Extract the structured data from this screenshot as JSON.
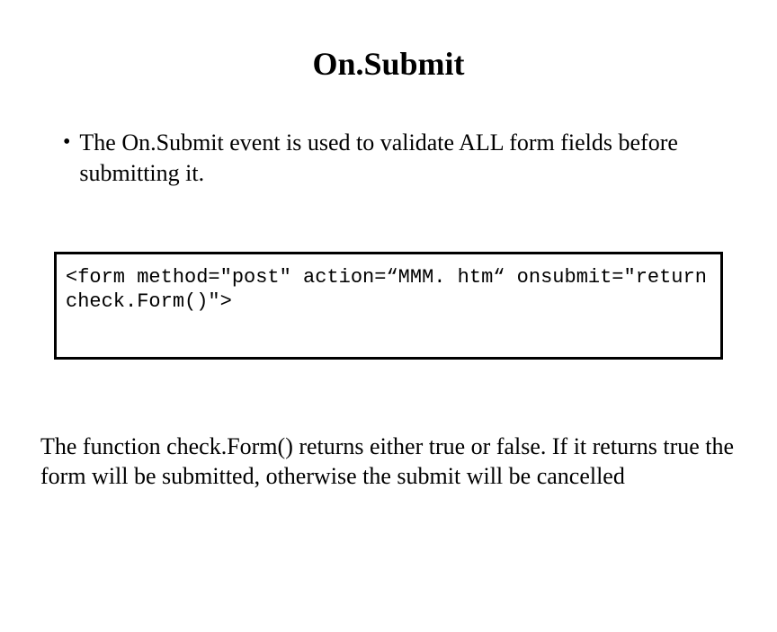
{
  "title": "On.Submit",
  "bullet": "The On.Submit event is used to validate ALL form fields before submitting it.",
  "code": "<form method=\"post\" action=“MMM. htm“ onsubmit=\"return check.Form()\">",
  "footer": "The function check.Form() returns either true or false. If it returns true the form will be submitted, otherwise the submit will be cancelled"
}
